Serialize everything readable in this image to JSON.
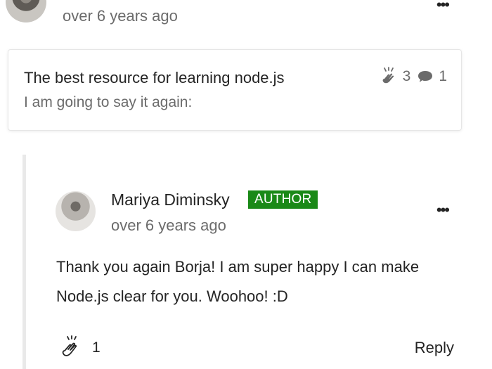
{
  "top_comment": {
    "timestamp": "over 6 years ago",
    "more_label": "•••"
  },
  "referenced_post": {
    "title": "The best resource for learning node.js",
    "subtitle": "I am going to say it again:",
    "claps": "3",
    "responses": "1",
    "clap_icon": "clap-icon",
    "response_icon": "speech-bubble-icon"
  },
  "reply": {
    "author": "Mariya Diminsky",
    "badge": "AUTHOR",
    "timestamp": "over 6 years ago",
    "more_label": "•••",
    "body": "Thank you again Borja! I am super happy I can make Node.js clear for you. Woohoo! :D",
    "claps": "1",
    "reply_label": "Reply",
    "clap_icon": "clap-icon"
  },
  "colors": {
    "badge": "#1a8917",
    "secondary_text": "#6b6b6b",
    "thread_line": "#e9e9e9"
  }
}
